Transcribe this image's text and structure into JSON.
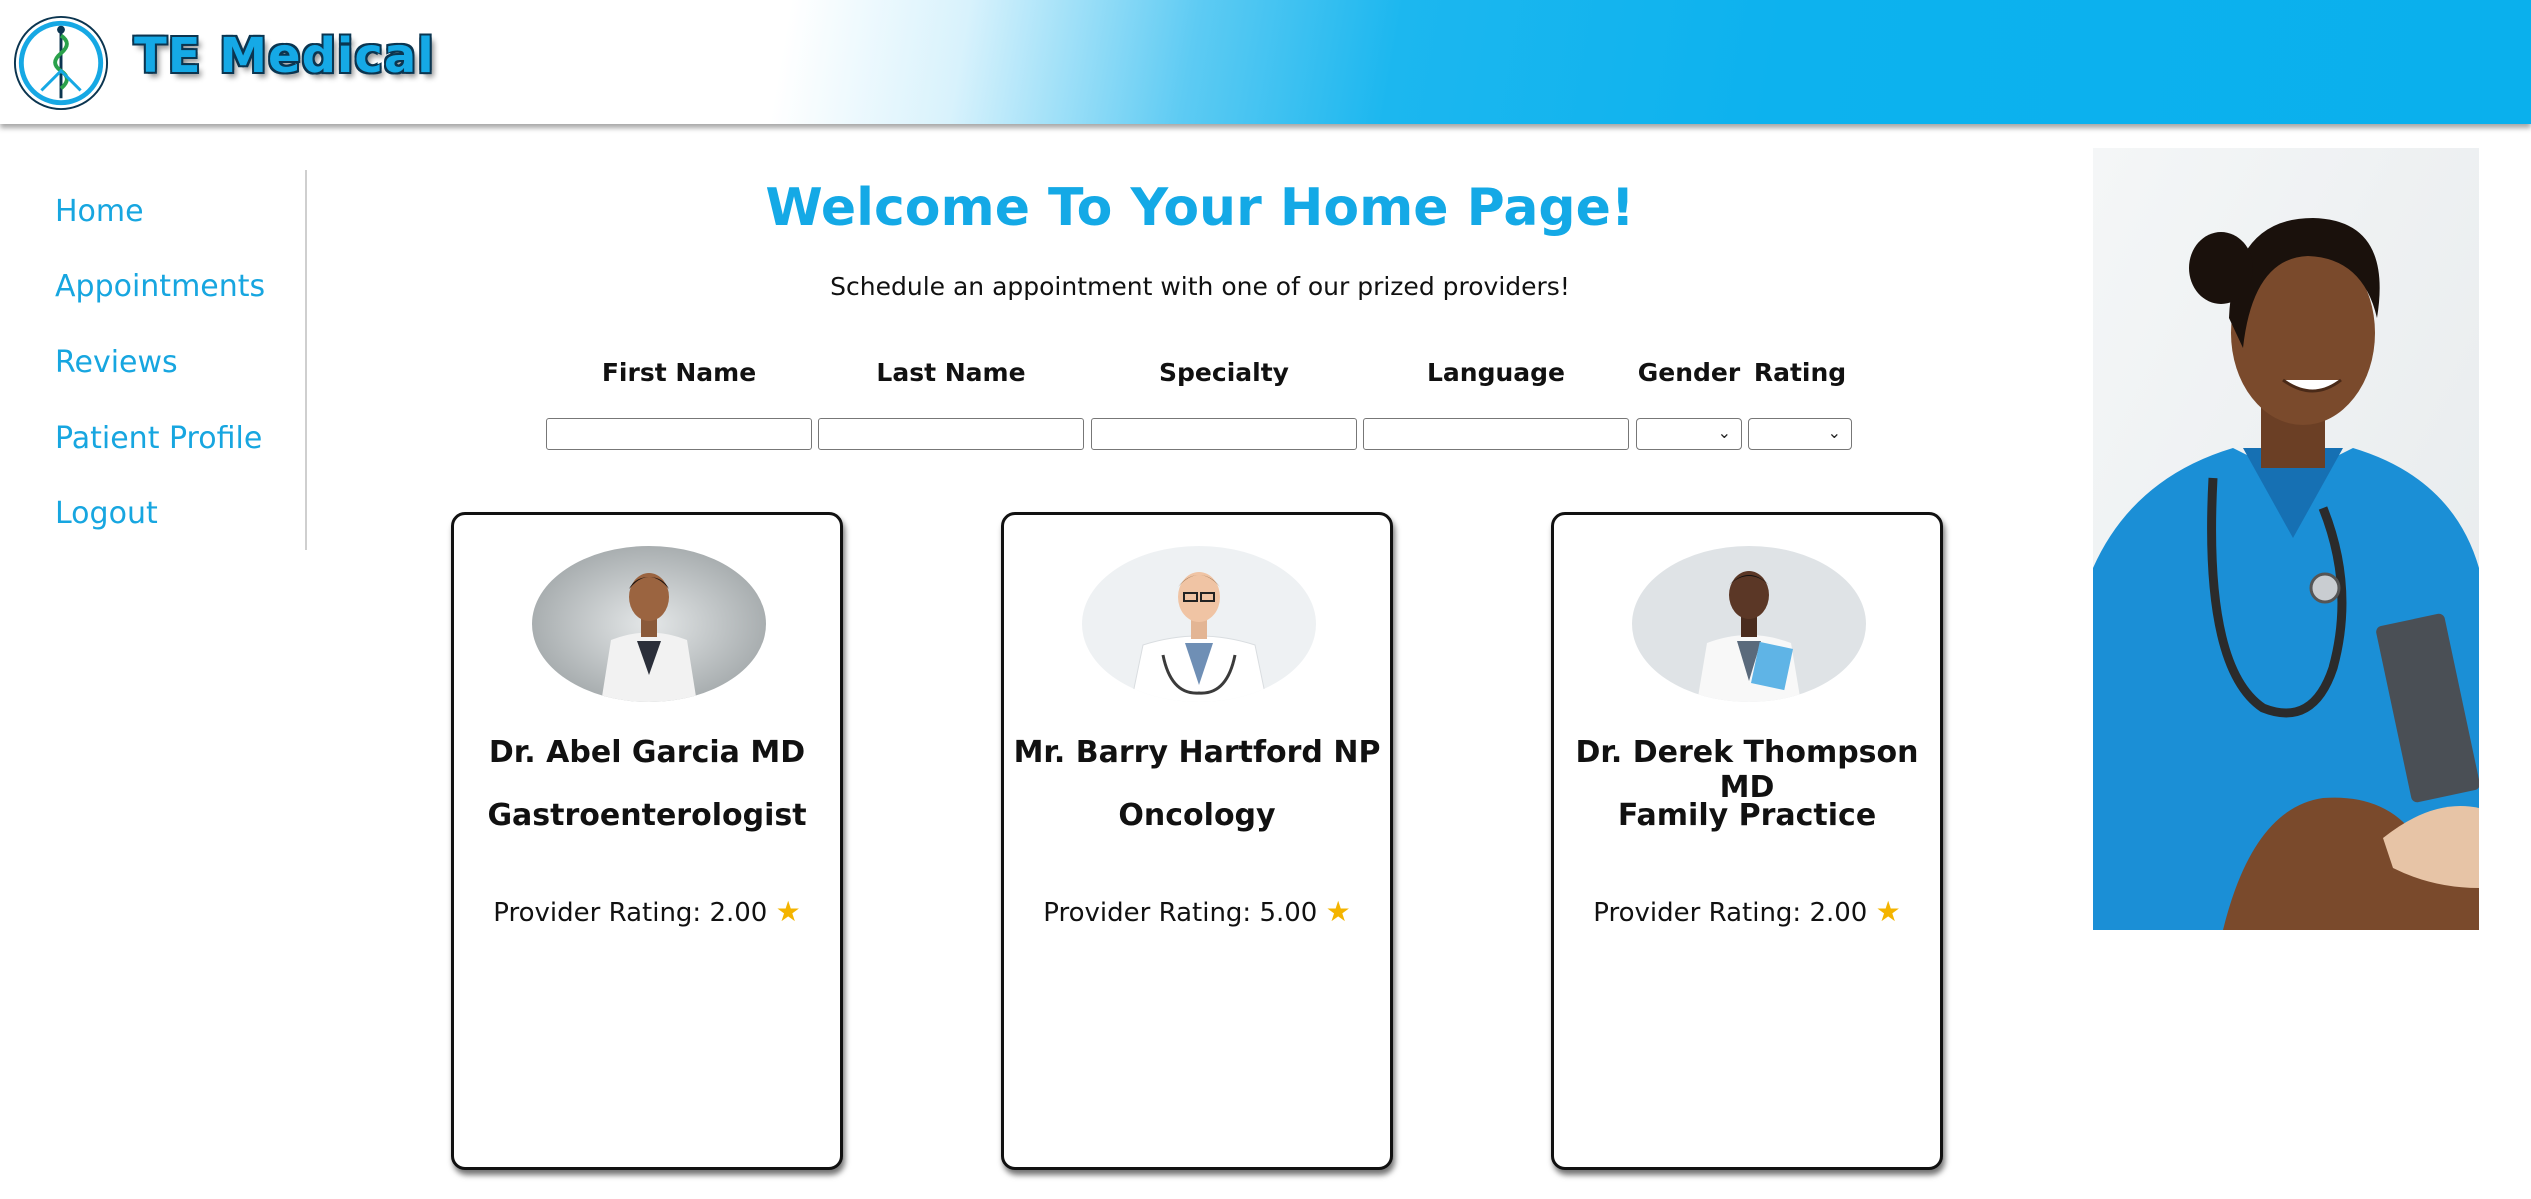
{
  "header": {
    "brand": "TE Medical",
    "logo_icon": "caduceus-icon",
    "colors": {
      "header_blue": "#0ab0ed",
      "brand_text": "#15a9e6"
    }
  },
  "sidebar": {
    "items": [
      {
        "label": "Home"
      },
      {
        "label": "Appointments"
      },
      {
        "label": "Reviews"
      },
      {
        "label": "Patient Profile"
      },
      {
        "label": "Logout"
      }
    ]
  },
  "main": {
    "title": "Welcome To Your Home Page!",
    "subtitle": "Schedule an appointment with one of our prized providers!",
    "filters": {
      "first_name": {
        "label": "First Name",
        "value": ""
      },
      "last_name": {
        "label": "Last Name",
        "value": ""
      },
      "specialty": {
        "label": "Specialty",
        "value": ""
      },
      "language": {
        "label": "Language",
        "value": ""
      },
      "gender": {
        "label": "Gender",
        "value": ""
      },
      "rating": {
        "label": "Rating",
        "value": ""
      }
    },
    "providers": [
      {
        "name": "Dr. Abel Garcia MD",
        "specialty": "Gastroenterologist",
        "rating_text": "Provider Rating: 2.00",
        "rating": 2.0
      },
      {
        "name": "Mr. Barry Hartford NP",
        "specialty": "Oncology",
        "rating_text": "Provider Rating: 5.00",
        "rating": 5.0
      },
      {
        "name": "Dr. Derek Thompson MD",
        "specialty": "Family Practice",
        "rating_text": "Provider Rating: 2.00",
        "rating": 2.0
      }
    ],
    "rating_icon": "star-icon",
    "accent_color": "#14a9e6"
  }
}
